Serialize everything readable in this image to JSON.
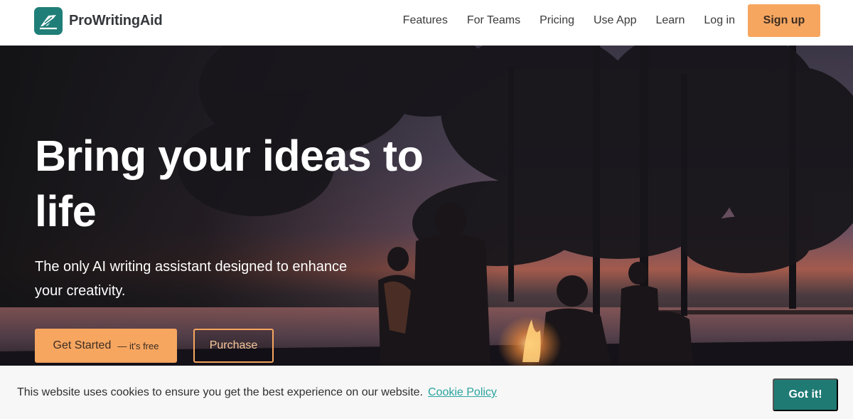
{
  "brand": {
    "name": "ProWritingAid",
    "logo_icon": "pen-feather-icon",
    "color": "#1f7e78"
  },
  "nav": {
    "items": [
      {
        "label": "Features"
      },
      {
        "label": "For Teams"
      },
      {
        "label": "Pricing"
      },
      {
        "label": "Use App"
      },
      {
        "label": "Learn"
      },
      {
        "label": "Log in"
      }
    ],
    "signup_label": "Sign up",
    "accent": "#f7a660"
  },
  "hero": {
    "headline": "Bring your ideas to life",
    "subhead": "The only AI writing assistant designed to enhance your creativity.",
    "get_started_label": "Get Started",
    "get_started_note": "— it's free",
    "purchase_label": "Purchase"
  },
  "cookie": {
    "message": "This website uses cookies to ensure you get the best experience on our website.",
    "policy_link": "Cookie Policy",
    "accept_label": "Got it!",
    "accept_color": "#1f7a74"
  }
}
